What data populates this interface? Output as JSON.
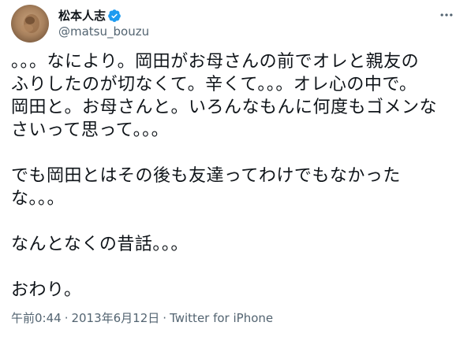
{
  "author": {
    "display_name": "松本人志",
    "handle": "@matsu_bouzu",
    "verified": true,
    "avatar_icon": "avatar-photo-icon"
  },
  "menu_icon": "more-horizontal-icon",
  "tweet": {
    "text": "。。。なにより。岡田がお母さんの前でオレと親友の\nふりしたのが切なくて。辛くて。。。オレ心の中で。\n岡田と。お母さんと。いろんなもんに何度もゴメンな\nさいって思って。。。\n\nでも岡田とはその後も友達ってわけでもなかった\nな。。。\n\nなんとなくの昔話。。。\n\nおわり。"
  },
  "meta": {
    "time": "午前0:44",
    "separator": "·",
    "date": "2013年6月12日",
    "source": "Twitter for iPhone"
  },
  "colors": {
    "text_primary": "#0f1419",
    "text_secondary": "#536471",
    "verified_blue": "#1d9bf0"
  }
}
